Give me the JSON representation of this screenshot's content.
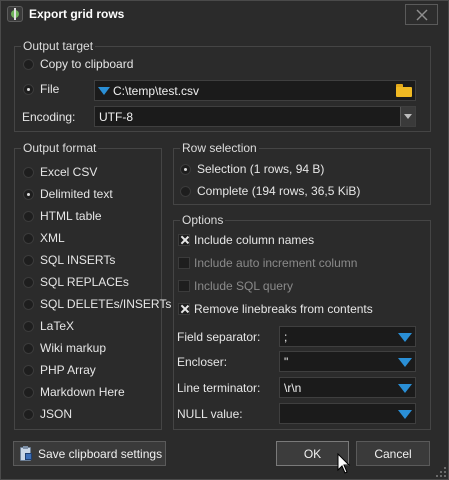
{
  "window": {
    "title": "Export grid rows"
  },
  "output_target": {
    "legend": "Output target",
    "copy_to_clipboard": "Copy to clipboard",
    "file_label": "File",
    "file_path": "C:\\temp\\test.csv",
    "encoding_label": "Encoding:",
    "encoding_value": "UTF-8"
  },
  "output_format": {
    "legend": "Output format",
    "options": [
      "Excel CSV",
      "Delimited text",
      "HTML table",
      "XML",
      "SQL INSERTs",
      "SQL REPLACEs",
      "SQL DELETEs/INSERTs",
      "LaTeX",
      "Wiki markup",
      "PHP Array",
      "Markdown Here",
      "JSON"
    ],
    "selected": "Delimited text"
  },
  "row_selection": {
    "legend": "Row selection",
    "selection": "Selection (1 rows, 94 B)",
    "complete": "Complete (194 rows, 36,5 KiB)",
    "selected": "Selection (1 rows, 94 B)"
  },
  "options": {
    "legend": "Options",
    "include_column_names": "Include column names",
    "include_auto_increment": "Include auto increment column",
    "include_sql_query": "Include SQL query",
    "remove_linebreaks": "Remove linebreaks from contents",
    "field_separator_label": "Field separator:",
    "field_separator_value": ";",
    "encloser_label": "Encloser:",
    "encloser_value": "\"",
    "line_terminator_label": "Line terminator:",
    "line_terminator_value": "\\r\\n",
    "null_value_label": "NULL value:",
    "null_value_value": ""
  },
  "buttons": {
    "save_clipboard": "Save clipboard settings",
    "ok": "OK",
    "cancel": "Cancel"
  },
  "icons": {
    "app": "heidisql-app-icon",
    "close": "close-icon",
    "folder": "folder-icon",
    "clipboard": "clipboard-save-icon",
    "cursor": "mouse-cursor-icon"
  },
  "colors": {
    "accent": "#2a8fd6",
    "background": "#2b2b2b",
    "input": "#1b1b1b"
  }
}
